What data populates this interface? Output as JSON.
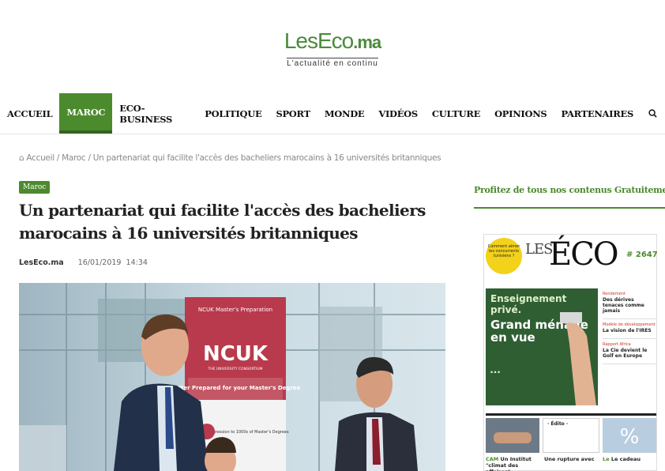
{
  "logo": {
    "name": "LesEco",
    "suffix": ".ma",
    "tagline": "L'actualité en continu"
  },
  "nav": {
    "items": [
      {
        "label": "ACCUEIL",
        "active": false
      },
      {
        "label": "MAROC",
        "active": true
      },
      {
        "label": "ECO-BUSINESS",
        "active": false
      },
      {
        "label": "POLITIQUE",
        "active": false
      },
      {
        "label": "SPORT",
        "active": false
      },
      {
        "label": "MONDE",
        "active": false
      },
      {
        "label": "VIDÉOS",
        "active": false
      },
      {
        "label": "CULTURE",
        "active": false
      },
      {
        "label": "OPINIONS",
        "active": false
      },
      {
        "label": "PARTENAIRES",
        "active": false
      }
    ],
    "search_icon": "search-icon"
  },
  "breadcrumb": {
    "home_icon": "home-icon",
    "text": "Accueil / Maroc / Un partenariat qui facilite l'accès des bacheliers marocains à 16 universités britanniques"
  },
  "article": {
    "category": "Maroc",
    "title": "Un partenariat qui facilite l'accès des bacheliers marocains à 16 universités britanniques",
    "author": "LesEco.ma",
    "date": "16/01/2019",
    "time": "14:34",
    "image_banner": {
      "top": "NCUK Master's Preparation",
      "logo": "NCUK",
      "sub": "THE UNIVERSITY CONSORTIUM",
      "mid": "Better Prepared for your Master's Degree",
      "low": "Guaranteed Progression to 1000s of Master's Degrees"
    }
  },
  "sidebar": {
    "promo": "Profitez de tous nos contenus Gratuitement !",
    "cover": {
      "badge": "Comment aimer les concurrents tunisiens ?",
      "les": "LES",
      "eco": "ÉCO",
      "issue": "# 2647",
      "green_title": "Enseignement privé.",
      "green_headline": "Grand ménage en vue",
      "side1_label": "Rendement",
      "side1": "Des dérives tenaces comme jamais",
      "side2_label": "Modèle de développement",
      "side2": "La vision de l'IRES",
      "side3_label": "Rapport Africa",
      "side3": "La Cie devient le Golf en Europe",
      "edito": "· Édito ·",
      "bottom1a": "CAM",
      "bottom1b": " Un Institut \"climat des affaires\"",
      "bottom2": "Une rupture avec",
      "bottom3a": "Le",
      "bottom3b": " Le cadeau"
    }
  },
  "colors": {
    "brand_green": "#4c8a2e"
  }
}
